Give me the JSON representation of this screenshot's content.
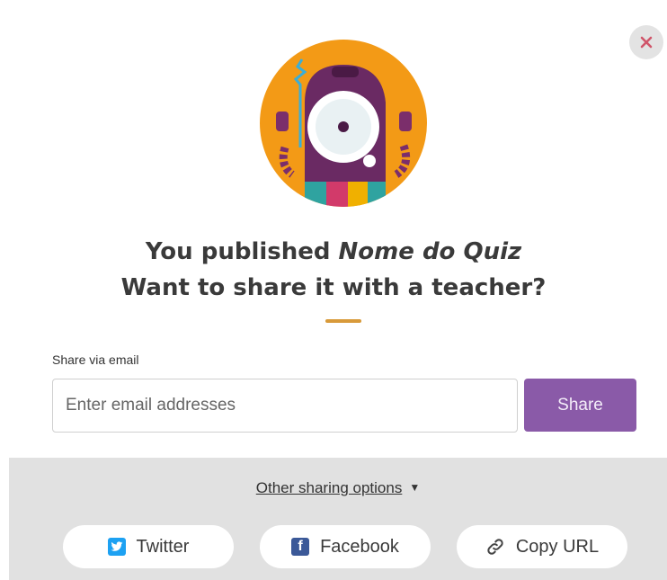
{
  "dialog": {
    "title_prefix": "You published ",
    "quiz_name": "Nome do Quiz",
    "title_line2": "Want to share it with a teacher?",
    "close_icon": "close-icon"
  },
  "email": {
    "label": "Share via email",
    "placeholder": "Enter email addresses",
    "value": "",
    "share_label": "Share"
  },
  "other": {
    "options_label": "Other sharing options",
    "buttons": [
      {
        "label": "Twitter",
        "icon": "twitter-icon"
      },
      {
        "label": "Facebook",
        "icon": "facebook-icon"
      },
      {
        "label": "Copy URL",
        "icon": "link-icon"
      }
    ]
  },
  "colors": {
    "accent_purple": "#8a5aa8",
    "divider": "#d89a3a",
    "twitter": "#1da1f2",
    "facebook": "#3b5998",
    "mascot_circle": "#f39a16"
  }
}
